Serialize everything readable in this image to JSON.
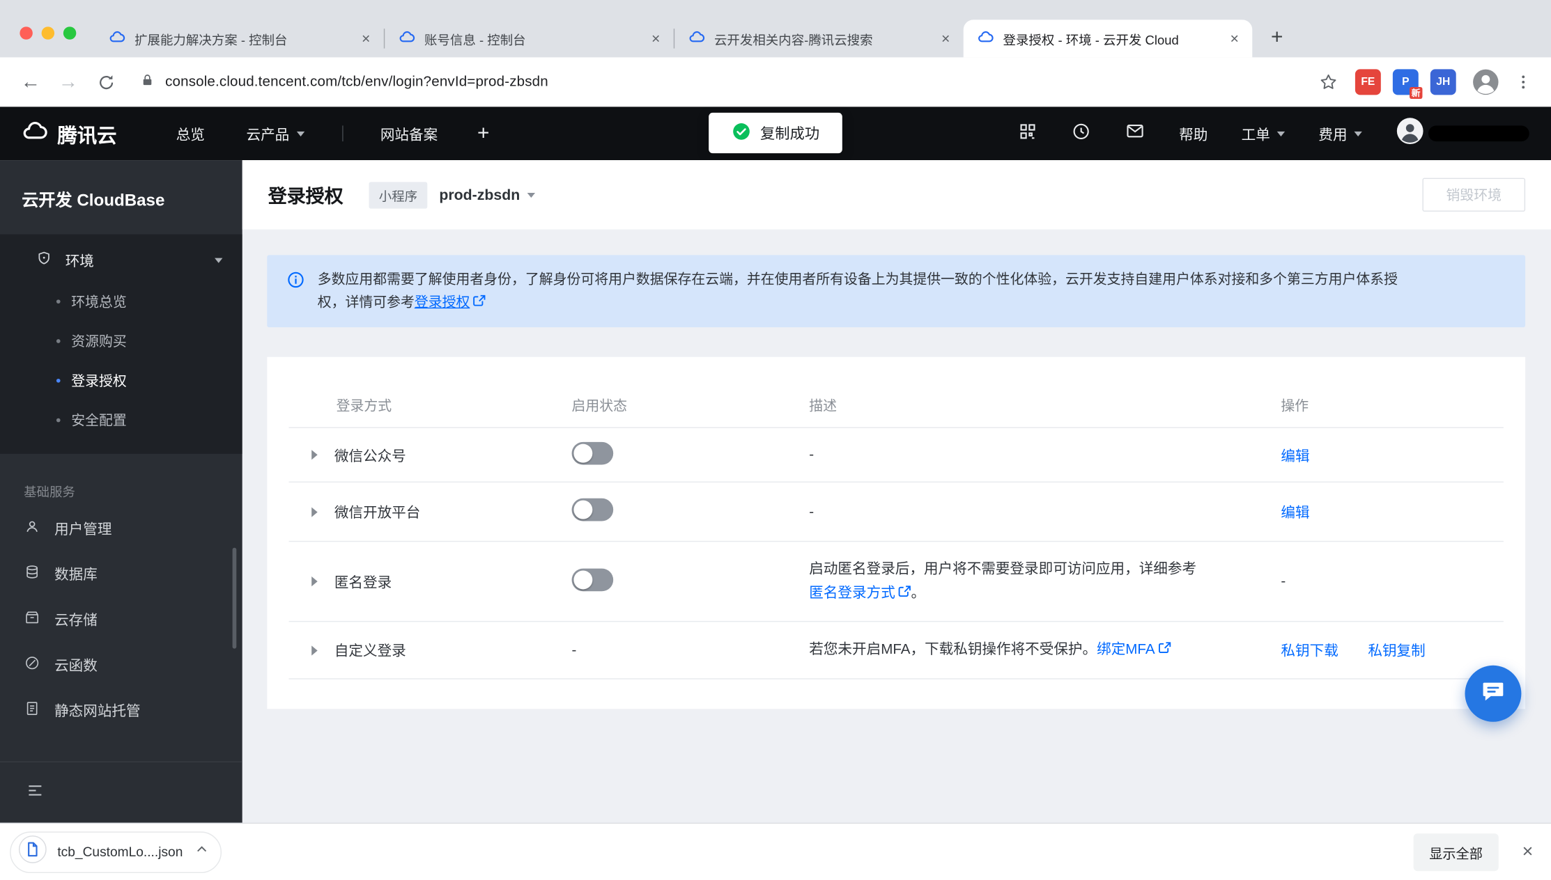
{
  "colors": {
    "accent": "#0069ff",
    "success": "#0abf5b",
    "brand_blue": "#2468f2"
  },
  "browser": {
    "tabs": [
      {
        "title": "扩展能力解决方案 - 控制台",
        "favicon": "tencent-cloud-icon"
      },
      {
        "title": "账号信息 - 控制台",
        "favicon": "tencent-cloud-icon"
      },
      {
        "title": "云开发相关内容-腾讯云搜索",
        "favicon": "tencent-cloud-icon"
      },
      {
        "title": "登录授权 - 环境 - 云开发 Cloud",
        "favicon": "tencent-cloud-icon",
        "active": true
      }
    ],
    "tab_close_glyph": "×",
    "new_tab_label": "+",
    "url": "console.cloud.tencent.com/tcb/env/login?envId=prod-zbsdn",
    "extensions": [
      {
        "label": "FE"
      },
      {
        "label": "P",
        "badge": "新"
      },
      {
        "label": "JH"
      }
    ]
  },
  "topnav": {
    "brand": "腾讯云",
    "overview": "总览",
    "products": "云产品",
    "beian": "网站备案",
    "add_label": "+",
    "toast": "复制成功",
    "help": "帮助",
    "ticket": "工单",
    "billing": "费用"
  },
  "sidebar": {
    "title": "云开发 CloudBase",
    "env": {
      "label": "环境",
      "items": [
        {
          "label": "环境总览"
        },
        {
          "label": "资源购买"
        },
        {
          "label": "登录授权",
          "active": true
        },
        {
          "label": "安全配置"
        }
      ]
    },
    "section": "基础服务",
    "services": [
      {
        "label": "用户管理",
        "icon": "user-icon"
      },
      {
        "label": "数据库",
        "icon": "database-icon"
      },
      {
        "label": "云存储",
        "icon": "storage-box-icon"
      },
      {
        "label": "云函数",
        "icon": "function-icon"
      },
      {
        "label": "静态网站托管",
        "icon": "document-icon"
      }
    ]
  },
  "page": {
    "title": "登录授权",
    "env_type_tag": "小程序",
    "env_id": "prod-zbsdn",
    "destroy_button": "销毁环境",
    "banner": {
      "line1": "多数应用都需要了解使用者身份，了解身份可将用户数据保存在云端，并在使用者所有设备上为其提供一致的个性化体验，云开发支持自建用户体系对接和多个第三方用户体系授",
      "line2_prefix": "权，详情可参考",
      "line2_link": "登录授权"
    },
    "table": {
      "headers": [
        "登录方式",
        "启用状态",
        "描述",
        "操作"
      ],
      "rows": [
        {
          "method": "微信公众号",
          "toggle": "off",
          "desc": "-",
          "action": "编辑"
        },
        {
          "method": "微信开放平台",
          "toggle": "off",
          "desc": "-",
          "action": "编辑"
        },
        {
          "method": "匿名登录",
          "toggle": "off",
          "desc_line1": "启动匿名登录后，用户将不需要登录即可访问应用，详细参考",
          "desc_link": "匿名登录方式",
          "desc_suffix": "。",
          "action": "-"
        },
        {
          "method": "自定义登录",
          "status_text": "-",
          "desc_prefix": "若您未开启MFA，下载私钥操作将不受保护。",
          "desc_link": "绑定MFA",
          "actions": [
            "私钥下载",
            "私钥复制"
          ]
        }
      ]
    }
  },
  "download_bar": {
    "filename": "tcb_CustomLo....json",
    "show_all": "显示全部",
    "close_glyph": "×"
  }
}
